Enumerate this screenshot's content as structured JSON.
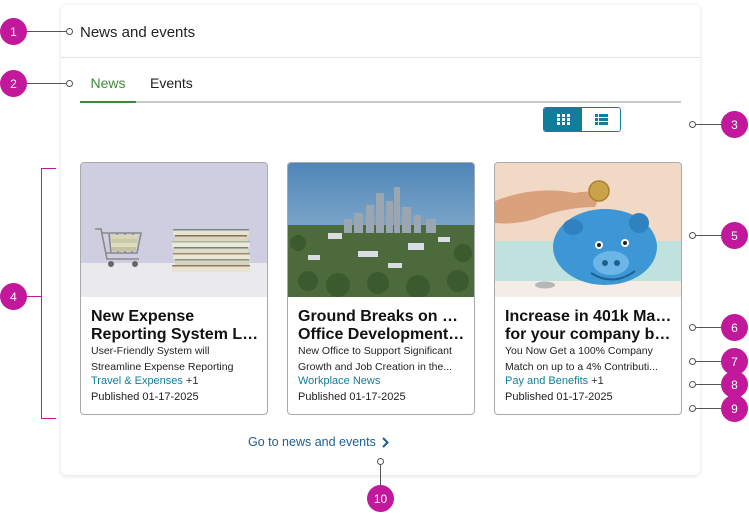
{
  "panel": {
    "title": "News and events"
  },
  "tabs": [
    {
      "label": "News",
      "active": true
    },
    {
      "label": "Events",
      "active": false
    }
  ],
  "view_toggle": {
    "grid_icon": "grid-icon",
    "list_icon": "list-icon",
    "selected": "grid"
  },
  "cards": [
    {
      "image": "shopping-cart-and-books-image",
      "title_line1": "New Expense",
      "title_line2": "Reporting System Lau...",
      "desc_line1": "User-Friendly System will",
      "desc_line2": "Streamline Expense Reporting",
      "category": "Travel & Expenses",
      "category_more": "+1",
      "published": "Published 01-17-2025"
    },
    {
      "image": "city-skyline-image",
      "title_line1": "Ground Breaks on New",
      "title_line2": "Office Development i...",
      "desc_line1": "New Office to Support Significant",
      "desc_line2": "Growth and Job Creation in the...",
      "category": "Workplace News",
      "category_more": "",
      "published": "Published 01-17-2025"
    },
    {
      "image": "piggy-bank-image",
      "title_line1": "Increase in 401k Match",
      "title_line2": "for your company ben...",
      "desc_line1": "You Now Get a 100% Company",
      "desc_line2": "Match on up to a 4% Contributi...",
      "category": "Pay and Benefits",
      "category_more": "+1",
      "published": "Published 01-17-2025"
    }
  ],
  "footer": {
    "link_label": "Go to news and events",
    "icon": "chevron-right-icon"
  },
  "callouts": [
    "1",
    "2",
    "3",
    "4",
    "5",
    "6",
    "7",
    "8",
    "9",
    "10"
  ],
  "colors": {
    "accent": "#0f7e9a",
    "tab_active": "#3f8a3a",
    "link": "#1e5d95",
    "callout": "#c1189c"
  }
}
